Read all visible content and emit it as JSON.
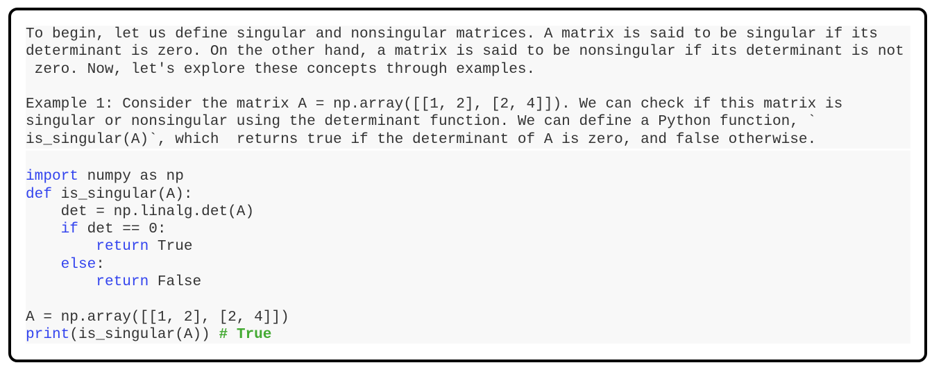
{
  "prose": {
    "lines": [
      "To begin, let us define singular and nonsingular matrices. A matrix is said to be singular if its",
      "determinant is zero. On the other hand, a matrix is said to be nonsingular if its determinant is not",
      " zero. Now, let's explore these concepts through examples.",
      "",
      "Example 1: Consider the matrix A = np.array([[1, 2], [2, 4]]). We can check if this matrix is",
      "singular or nonsingular using the determinant function. We can define a Python function, `",
      "is_singular(A)`, which  returns true if the determinant of A is zero, and false otherwise."
    ]
  },
  "code": {
    "lines": [
      [],
      [
        {
          "t": "import",
          "k": "kw"
        },
        {
          "t": " numpy as np",
          "k": ""
        }
      ],
      [
        {
          "t": "def",
          "k": "kw"
        },
        {
          "t": " is_singular(A):",
          "k": ""
        }
      ],
      [
        {
          "t": "    det = np.linalg.det(A)",
          "k": ""
        }
      ],
      [
        {
          "t": "    ",
          "k": ""
        },
        {
          "t": "if",
          "k": "kw"
        },
        {
          "t": " det == 0:",
          "k": ""
        }
      ],
      [
        {
          "t": "        ",
          "k": ""
        },
        {
          "t": "return",
          "k": "kw"
        },
        {
          "t": " True",
          "k": ""
        }
      ],
      [
        {
          "t": "    ",
          "k": ""
        },
        {
          "t": "else",
          "k": "kw"
        },
        {
          "t": ":",
          "k": ""
        }
      ],
      [
        {
          "t": "        ",
          "k": ""
        },
        {
          "t": "return",
          "k": "kw"
        },
        {
          "t": " False",
          "k": ""
        }
      ],
      [],
      [
        {
          "t": "A = np.array([[1, 2], [2, 4]])",
          "k": ""
        }
      ],
      [
        {
          "t": "print",
          "k": "kw"
        },
        {
          "t": "(is_singular(A)) ",
          "k": ""
        },
        {
          "t": "# True",
          "k": "cm"
        }
      ]
    ]
  },
  "colors": {
    "keyword": "#3344ee",
    "comment": "#44aa33",
    "text": "#333333"
  }
}
